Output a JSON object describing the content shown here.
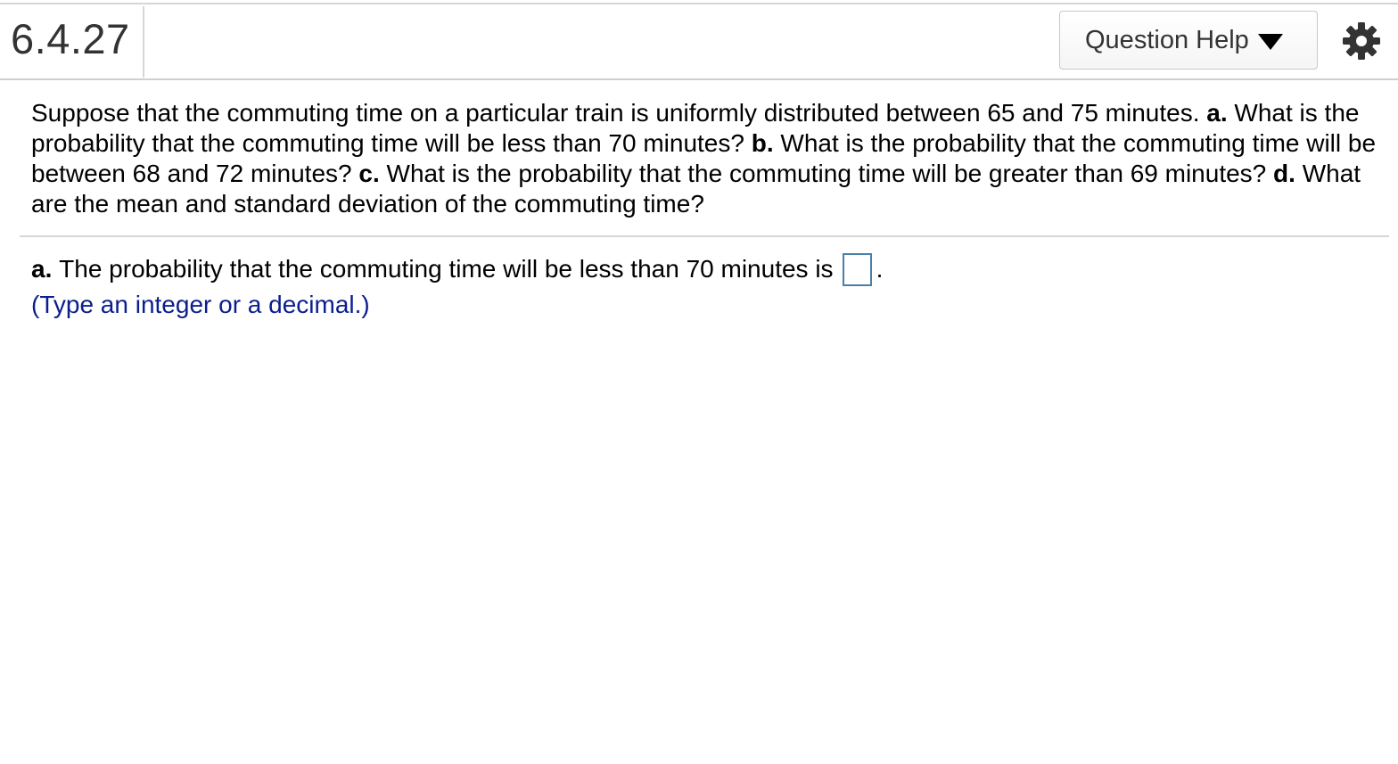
{
  "header": {
    "question_number": "6.4.27",
    "help_button_label": "Question Help"
  },
  "problem": {
    "intro": "Suppose that the commuting time on a particular train is uniformly distributed between 65 and 75 minutes.",
    "part_a_label": "a.",
    "part_a_text": "What is the probability that the commuting time will be less than 70 minutes?",
    "part_b_label": "b.",
    "part_b_text": "What is the probability that the commuting time will be between 68 and 72 minutes?",
    "part_c_label": "c.",
    "part_c_text": "What is the probability that the commuting time will be greater than 69 minutes?",
    "part_d_label": "d.",
    "part_d_text": "What are the mean and standard deviation of the commuting time?"
  },
  "answer": {
    "part_label": "a.",
    "prompt": "The probability that the commuting time will be less than 70 minutes is",
    "input_value": "",
    "trailing_punctuation": ".",
    "hint": "(Type an integer or a decimal.)"
  },
  "icons": {
    "settings": "gear-icon",
    "dropdown": "caret-down-icon"
  },
  "colors": {
    "hint_text": "#0b1e8e",
    "answer_box_border": "#4a7fa8"
  }
}
